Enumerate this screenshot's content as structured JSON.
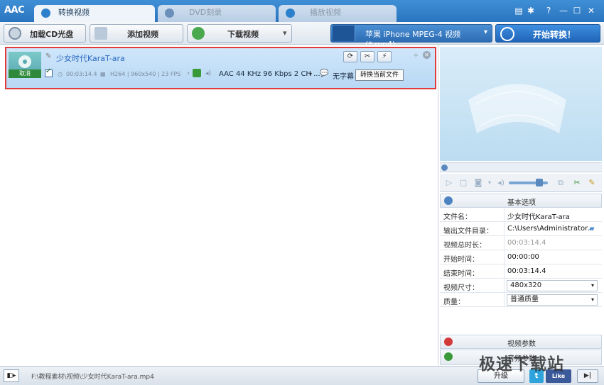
{
  "app": {
    "logo": "AAC"
  },
  "tabs": [
    {
      "label": "转换视频",
      "active": true
    },
    {
      "label": "DVD刻录",
      "active": false
    },
    {
      "label": "播放视频",
      "active": false
    }
  ],
  "window_controls": {
    "menu": "▤",
    "settings": "✱",
    "help": "?",
    "minimize": "—",
    "maximize": "☐",
    "close": "✕"
  },
  "toolbar": {
    "load_cd": "加载CD光盘",
    "add_video": "添加视频",
    "download_video": "下载视频",
    "download_arrow": "▾",
    "profile": "苹果 iPhone MPEG-4 视频 (*.mp4)",
    "profile_arrow": "▾",
    "start": "开始转换！"
  },
  "file": {
    "thumb_cancel": "取消",
    "name": "少女时代KaraT-ara",
    "duration": "00:03:14.4",
    "video_info": "H264 | 960x540 | 23 FPS",
    "audio": "AAC 44 KHz 96 Kbps 2 CH ...",
    "subtitle": "无字幕",
    "tooltip": "转换当前文件",
    "checked": true
  },
  "panel": {
    "basic_title": "基本选项",
    "rows": [
      {
        "key": "文件名：",
        "value": "少女时代KaraT-ara"
      },
      {
        "key": "输出文件目录：",
        "value": "C:\\Users\\Administrator..."
      },
      {
        "key": "视频总时长：",
        "value": "00:03:14.4"
      },
      {
        "key": "开始时间：",
        "value": "00:00:00"
      },
      {
        "key": "结束时间：",
        "value": "00:03:14.4"
      },
      {
        "key": "视频尺寸：",
        "value": "480x320"
      },
      {
        "key": "质量：",
        "value": "普通质量"
      }
    ],
    "video_params": "视频参数",
    "audio_params": "音频参数"
  },
  "status": {
    "path": "F:\\教程素材\\视频\\少女时代KaraT-ara.mp4",
    "upgrade": "升级",
    "twitter": "t",
    "facebook": "Like",
    "extra": "▶|"
  },
  "watermark": "极速下载站",
  "colors": {
    "titlebar": "#2a74bf",
    "accent": "#1f64b8",
    "selection": "#c4dff7",
    "highlight_border": "#e03a3a"
  }
}
